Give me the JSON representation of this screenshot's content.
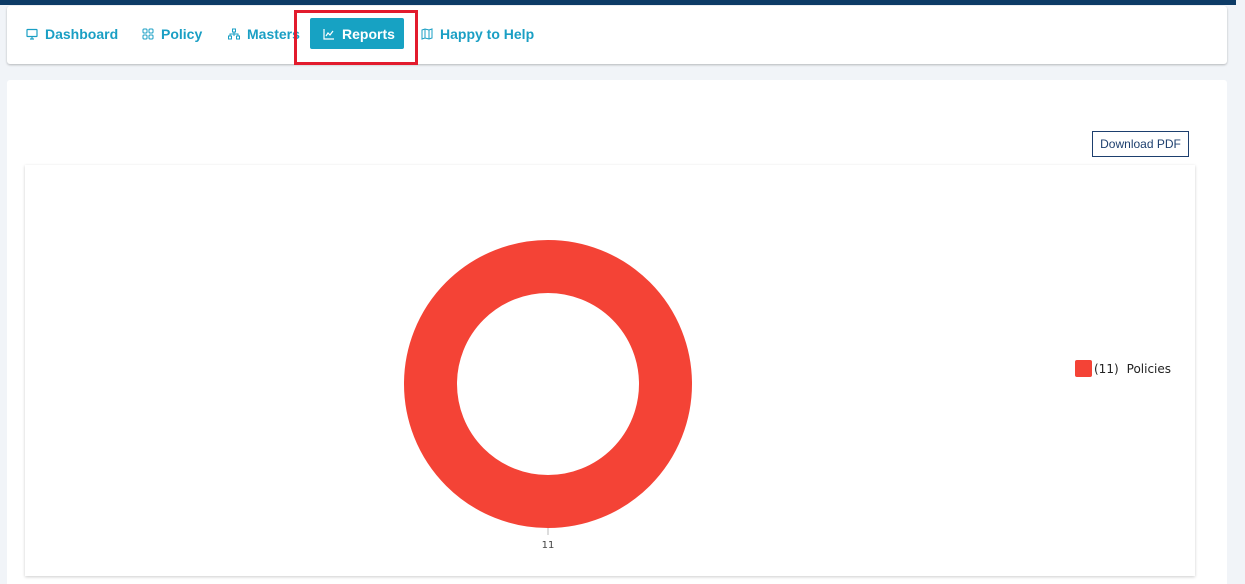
{
  "nav": {
    "items": [
      {
        "label": "Dashboard",
        "icon": "monitor-icon"
      },
      {
        "label": "Policy",
        "icon": "grid-icon"
      },
      {
        "label": "Masters",
        "icon": "sitemap-icon"
      },
      {
        "label": "Reports",
        "icon": "chart-icon",
        "active": true
      },
      {
        "label": "Happy to Help",
        "icon": "map-icon"
      }
    ]
  },
  "actions": {
    "download_pdf": "Download PDF"
  },
  "colors": {
    "accent": "#17a2c3",
    "nav_text": "#1a9fc4",
    "topbar": "#0d3b66",
    "highlight": "#e21b2d",
    "slice": "#f44336"
  },
  "chart_data": {
    "type": "pie",
    "variant": "donut",
    "categories": [
      "Policies"
    ],
    "values": [
      11
    ],
    "slice_labels": [
      "11"
    ],
    "legend": [
      {
        "count": "(11)",
        "label": "Policies"
      }
    ],
    "legend_position": "right",
    "colors": [
      "#f44336"
    ],
    "title": ""
  }
}
